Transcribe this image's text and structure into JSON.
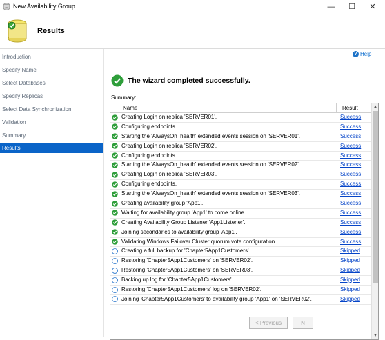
{
  "window": {
    "title": "New Availability Group",
    "minimize_glyph": "—",
    "maximize_glyph": "☐",
    "close_glyph": "✕"
  },
  "header": {
    "title": "Results",
    "icon": "database-wizard-icon"
  },
  "sidebar": {
    "items": [
      {
        "label": "Introduction",
        "active": false
      },
      {
        "label": "Specify Name",
        "active": false
      },
      {
        "label": "Select Databases",
        "active": false
      },
      {
        "label": "Specify Replicas",
        "active": false
      },
      {
        "label": "Select Data Synchronization",
        "active": false
      },
      {
        "label": "Validation",
        "active": false
      },
      {
        "label": "Summary",
        "active": false
      },
      {
        "label": "Results",
        "active": true
      }
    ]
  },
  "main": {
    "help_label": "Help",
    "help_icon": "?",
    "success_message": "The wizard completed successfully.",
    "summary_label": "Summary:",
    "columns": {
      "name": "Name",
      "result": "Result"
    },
    "rows": [
      {
        "status": "success",
        "name": "Creating Login on replica 'SERVER01'.",
        "result": "Success"
      },
      {
        "status": "success",
        "name": "Configuring endpoints.",
        "result": "Success"
      },
      {
        "status": "success",
        "name": "Starting the 'AlwaysOn_health' extended events session on 'SERVER01'.",
        "result": "Success"
      },
      {
        "status": "success",
        "name": "Creating Login on replica 'SERVER02'.",
        "result": "Success"
      },
      {
        "status": "success",
        "name": "Configuring endpoints.",
        "result": "Success"
      },
      {
        "status": "success",
        "name": "Starting the 'AlwaysOn_health' extended events session on 'SERVER02'.",
        "result": "Success"
      },
      {
        "status": "success",
        "name": "Creating Login on replica 'SERVER03'.",
        "result": "Success"
      },
      {
        "status": "success",
        "name": "Configuring endpoints.",
        "result": "Success"
      },
      {
        "status": "success",
        "name": "Starting the 'AlwaysOn_health' extended events session on 'SERVER03'.",
        "result": "Success"
      },
      {
        "status": "success",
        "name": "Creating availability group 'App1'.",
        "result": "Success"
      },
      {
        "status": "success",
        "name": "Waiting for availability group 'App1' to come online.",
        "result": "Success"
      },
      {
        "status": "success",
        "name": "Creating Availability Group Listener 'App1Listener'.",
        "result": "Success"
      },
      {
        "status": "success",
        "name": "Joining secondaries to availability group 'App1'.",
        "result": "Success"
      },
      {
        "status": "success",
        "name": "Validating Windows Failover Cluster quorum vote configuration",
        "result": "Success"
      },
      {
        "status": "info",
        "name": "Creating a full backup for 'Chapter5App1Customers'.",
        "result": "Skipped"
      },
      {
        "status": "info",
        "name": "Restoring 'Chapter5App1Customers' on 'SERVER02'.",
        "result": "Skipped"
      },
      {
        "status": "info",
        "name": "Restoring 'Chapter5App1Customers' on 'SERVER03'.",
        "result": "Skipped"
      },
      {
        "status": "info",
        "name": "Backing up log for 'Chapter5App1Customers'.",
        "result": "Skipped"
      },
      {
        "status": "info",
        "name": "Restoring 'Chapter5App1Customers' log on 'SERVER02'.",
        "result": "Skipped"
      },
      {
        "status": "info",
        "name": "Joining 'Chapter5App1Customers' to availability group 'App1' on 'SERVER02'.",
        "result": "Skipped"
      }
    ]
  },
  "footer": {
    "previous_label": "< Previous",
    "next_label": "N"
  },
  "colors": {
    "success": "#2e9e3a",
    "info": "#1f6fc8",
    "selected": "#0a64c8",
    "link": "#0645c8"
  }
}
